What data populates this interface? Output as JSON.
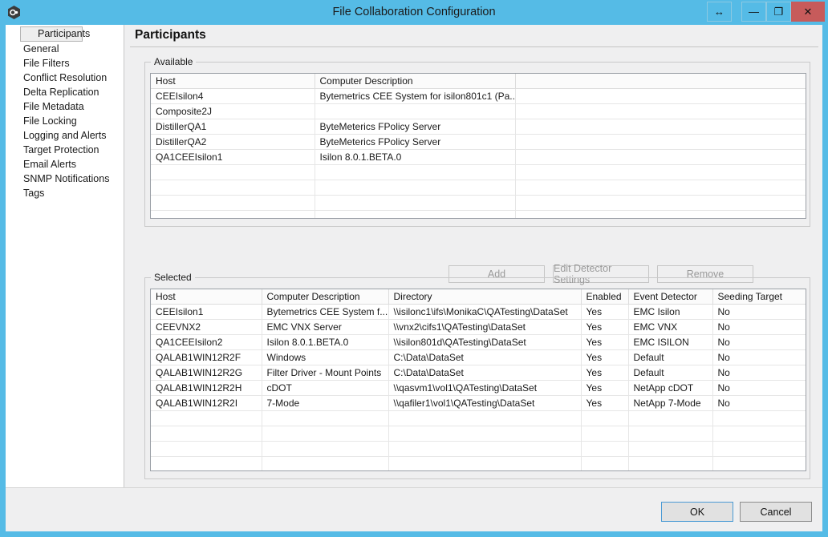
{
  "window": {
    "title": "File Collaboration Configuration",
    "icon": "app-hexagon-icon",
    "controls": {
      "resize": "↔",
      "minimize": "—",
      "maximize": "❐",
      "close": "✕"
    },
    "accent_color": "#55bbe6",
    "close_color": "#c75b5b"
  },
  "sidebar": {
    "items": [
      {
        "label": "Participants",
        "selected": true
      },
      {
        "label": "General",
        "selected": false
      },
      {
        "label": "File Filters",
        "selected": false
      },
      {
        "label": "Conflict Resolution",
        "selected": false
      },
      {
        "label": "Delta Replication",
        "selected": false
      },
      {
        "label": "File Metadata",
        "selected": false
      },
      {
        "label": "File Locking",
        "selected": false
      },
      {
        "label": "Logging and Alerts",
        "selected": false
      },
      {
        "label": "Target Protection",
        "selected": false
      },
      {
        "label": "Email Alerts",
        "selected": false
      },
      {
        "label": "SNMP Notifications",
        "selected": false
      },
      {
        "label": "Tags",
        "selected": false
      }
    ]
  },
  "content": {
    "heading": "Participants",
    "available": {
      "group_label": "Available",
      "columns": [
        "Host",
        "Computer Description",
        ""
      ],
      "rows": [
        [
          "CEEIsilon4",
          "Bytemetrics CEE System for isilon801c1 (Pa...",
          ""
        ],
        [
          "Composite2J",
          "",
          ""
        ],
        [
          "DistillerQA1",
          "ByteMeterics FPolicy Server",
          ""
        ],
        [
          "DistillerQA2",
          "ByteMeterics FPolicy Server",
          ""
        ],
        [
          "QA1CEEIsilon1",
          "Isilon 8.0.1.BETA.0",
          ""
        ],
        [
          "",
          "",
          ""
        ],
        [
          "",
          "",
          ""
        ],
        [
          "",
          "",
          ""
        ],
        [
          "",
          "",
          ""
        ]
      ]
    },
    "buttons": {
      "add": "Add",
      "edit_detector_settings": "Edit Detector Settings",
      "remove": "Remove"
    },
    "selected": {
      "group_label": "Selected",
      "columns": [
        "Host",
        "Computer Description",
        "Directory",
        "Enabled",
        "Event Detector",
        "Seeding Target"
      ],
      "rows": [
        [
          "CEEIsilon1",
          "Bytemetrics CEE System f...",
          "\\\\isilonc1\\ifs\\MonikaC\\QATesting\\DataSet",
          "Yes",
          "EMC Isilon",
          "No"
        ],
        [
          "CEEVNX2",
          "EMC VNX Server",
          "\\\\vnx2\\cifs1\\QATesting\\DataSet",
          "Yes",
          "EMC VNX",
          "No"
        ],
        [
          "QA1CEEIsilon2",
          "Isilon 8.0.1.BETA.0",
          "\\\\isilon801d\\QATesting\\DataSet",
          "Yes",
          "EMC ISILON",
          "No"
        ],
        [
          "QALAB1WIN12R2F",
          "Windows",
          "C:\\Data\\DataSet",
          "Yes",
          "Default",
          "No"
        ],
        [
          "QALAB1WIN12R2G",
          "Filter Driver - Mount Points",
          "C:\\Data\\DataSet",
          "Yes",
          "Default",
          "No"
        ],
        [
          "QALAB1WIN12R2H",
          "cDOT",
          "\\\\qasvm1\\vol1\\QATesting\\DataSet",
          "Yes",
          "NetApp cDOT",
          "No"
        ],
        [
          "QALAB1WIN12R2I",
          "7-Mode",
          "\\\\qafiler1\\vol1\\QATesting\\DataSet",
          "Yes",
          "NetApp 7-Mode",
          "No"
        ],
        [
          "",
          "",
          "",
          "",
          "",
          ""
        ],
        [
          "",
          "",
          "",
          "",
          "",
          ""
        ],
        [
          "",
          "",
          "",
          "",
          "",
          ""
        ],
        [
          "",
          "",
          "",
          "",
          "",
          ""
        ]
      ]
    }
  },
  "footer": {
    "ok": "OK",
    "cancel": "Cancel"
  }
}
